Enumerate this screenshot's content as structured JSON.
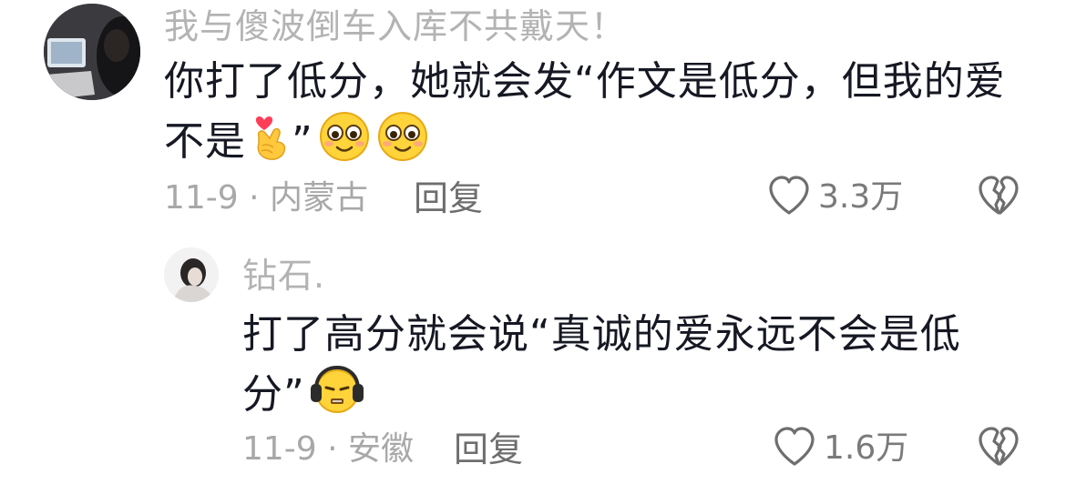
{
  "comments": [
    {
      "username": "我与傻波倒车入库不共戴天！",
      "content_line1": "你打了低分，她就会发“作文是低分，但我的爱",
      "content_line2_prefix": "不是",
      "content_line2_suffix": "”",
      "content_emojis": [
        "finger-heart-emoji",
        "smiling-emoji",
        "smiling-emoji"
      ],
      "meta": "11-9 · 内蒙古",
      "reply_label": "回复",
      "like_count": "3.3万"
    },
    {
      "username": "钻石.",
      "content_line1": "打了高分就会说“真诚的爱永远不会是低",
      "content_line2_prefix": "分”",
      "content_emojis": [
        "headphone-emoji"
      ],
      "meta": "11-9 · 安徽",
      "reply_label": "回复",
      "like_count": "1.6万"
    }
  ],
  "colors": {
    "username": "#b3b3b3",
    "content": "#161823",
    "meta": "#a8a8a8",
    "reply": "#6e6e6e",
    "icon": "#6e6e6e"
  }
}
